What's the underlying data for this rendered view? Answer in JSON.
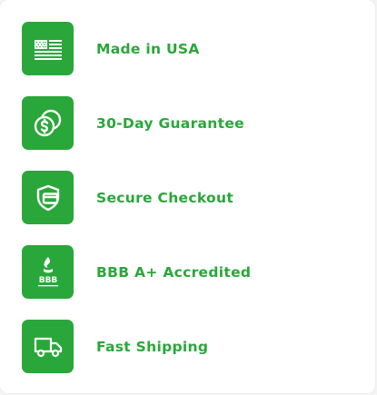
{
  "colors": {
    "accent": "#2aa73a",
    "background": "#ffffff"
  },
  "features": [
    {
      "label": "Made in USA",
      "icon": "usa-flag-icon"
    },
    {
      "label": "30-Day Guarantee",
      "icon": "money-back-coins-icon"
    },
    {
      "label": "Secure Checkout",
      "icon": "secure-card-shield-icon"
    },
    {
      "label": "BBB A+ Accredited",
      "icon": "bbb-logo-icon"
    },
    {
      "label": "Fast Shipping",
      "icon": "delivery-truck-icon"
    }
  ]
}
